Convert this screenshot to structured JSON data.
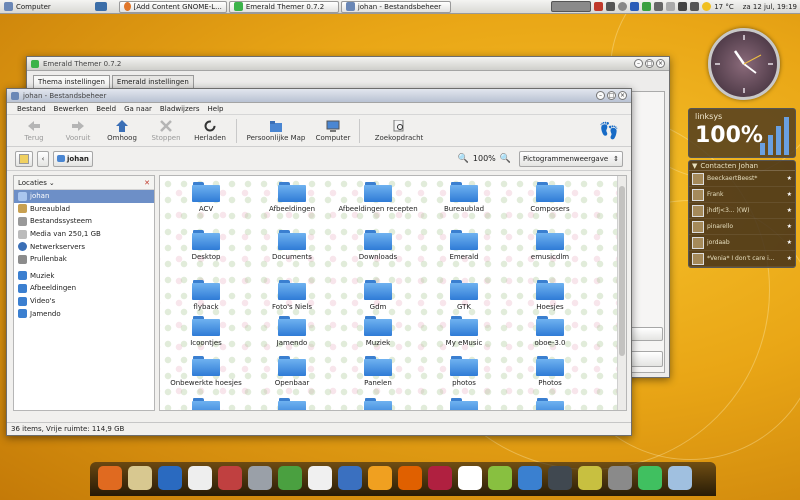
{
  "top_panel": {
    "computer_label": "Computer",
    "tasks": [
      {
        "label": "[Add Content GNOME-L..."
      },
      {
        "label": "Emerald Themer 0.7.2"
      },
      {
        "label": "johan - Bestandsbeheer"
      }
    ],
    "weather": "17 °C",
    "datetime": "za 12 jul, 19:19"
  },
  "emerald_window": {
    "title": "Emerald Themer 0.7.2",
    "tabs": [
      "Thema instellingen",
      "Emerald instellingen"
    ]
  },
  "file_manager": {
    "title": "johan - Bestandsbeheer",
    "menu": [
      "Bestand",
      "Bewerken",
      "Beeld",
      "Ga naar",
      "Bladwijzers",
      "Help"
    ],
    "toolbar": {
      "back": "Terug",
      "forward": "Vooruit",
      "up": "Omhoog",
      "stop": "Stoppen",
      "reload": "Herladen",
      "home": "Persoonlijke Map",
      "computer": "Computer",
      "search": "Zoekopdracht"
    },
    "location": "johan",
    "zoom": "100%",
    "view_mode": "Pictogrammenweergave",
    "sidebar_title": "Locaties",
    "places": [
      "johan",
      "Bureaublad",
      "Bestandssysteem",
      "Media van 250,1 GB",
      "Netwerkservers",
      "Prullenbak"
    ],
    "bookmarks": [
      "Muziek",
      "Afbeeldingen",
      "Video's",
      "Jamendo"
    ],
    "folders": [
      "ACV",
      "Afbeeldingen",
      "Afbeeldingen recepten",
      "Bureaublad",
      "Composers",
      "Desktop",
      "Documents",
      "Downloads",
      "Emerald",
      "emusicdlm",
      "flyback",
      "Foto's Niels",
      "Gdm",
      "GTK",
      "Hoesjes",
      "Icoontjes",
      "Jamendo",
      "Muziek",
      "My eMusic",
      "oboe-3.0",
      "Onbewerkte hoesjes",
      "Openbaar",
      "Panelen",
      "photos",
      "Photos",
      "",
      "",
      "",
      "",
      ""
    ],
    "status": "36 items, Vrije ruimte: 114,9 GB"
  },
  "widgets": {
    "wifi_name": "linksys",
    "wifi_signal": "100%",
    "contacts_title": "Contacten Johan",
    "contacts": [
      "BeeckaertBeest*",
      "Frank",
      "jhdfj<3... )(W)",
      "pinarello",
      "jordaab",
      "*Venia* I don't care i..."
    ]
  },
  "colors": {
    "desktop": "#e9a616",
    "folder_blue": "#2f7bd6",
    "selection": "#6d8fc7"
  }
}
